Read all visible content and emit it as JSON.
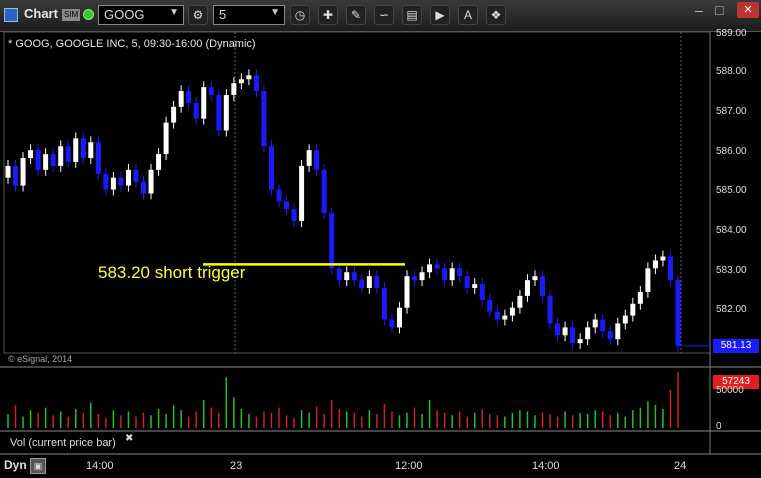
{
  "window": {
    "title": "Chart",
    "sim_badge": "SIM",
    "symbol": "GOOG",
    "interval": "5",
    "minimize": "–",
    "maximize": "□",
    "close": "✕"
  },
  "toolbar_icons": [
    "crosshair-icon",
    "pencil-icon",
    "draw-icon",
    "get-icon",
    "play-icon",
    "text-icon",
    "cursor-icon"
  ],
  "chart": {
    "title": "* GOOG, GOOGLE INC, 5, 09:30-16:00 (Dynamic)",
    "copyright": "© eSignal, 2014",
    "annotation": "583.20 short trigger",
    "last_price": "581.13",
    "price_ticks": [
      "589.00",
      "588.00",
      "587.00",
      "586.00",
      "585.00",
      "584.00",
      "583.00",
      "582.00"
    ],
    "time_ticks": [
      "14:00",
      "23",
      "12:00",
      "14:00",
      "24"
    ],
    "volume_label": "Vol (current price bar)",
    "volume_close": "✖",
    "volume_last": "57243",
    "volume_ticks": [
      "50000",
      "0"
    ],
    "bottom_label": "Dyn",
    "colors": {
      "up": "#ffffff",
      "down": "#1a1aff",
      "trigger": "#ffff00",
      "vol_up": "#22c222",
      "vol_down": "#d02020"
    }
  },
  "chart_data": {
    "type": "candlestick",
    "trigger_level": 583.2,
    "ylim": [
      580.95,
      589.1
    ],
    "last": 581.13,
    "closes": [
      585.7,
      585.2,
      585.9,
      586.1,
      585.6,
      586.0,
      585.7,
      586.2,
      585.8,
      586.4,
      585.9,
      586.3,
      585.5,
      585.1,
      585.4,
      585.2,
      585.6,
      585.3,
      585.0,
      585.6,
      586.0,
      586.8,
      587.2,
      587.6,
      587.3,
      586.9,
      587.7,
      587.5,
      586.6,
      587.5,
      587.8,
      587.9,
      588.0,
      587.6,
      586.2,
      585.1,
      584.8,
      584.6,
      584.3,
      585.7,
      586.1,
      585.6,
      584.5,
      583.1,
      582.8,
      583.0,
      582.8,
      582.6,
      582.9,
      582.6,
      581.8,
      581.6,
      582.1,
      582.9,
      582.8,
      583.0,
      583.2,
      583.1,
      582.8,
      583.1,
      582.9,
      582.6,
      582.7,
      582.3,
      582.0,
      581.8,
      581.9,
      582.1,
      582.4,
      582.8,
      582.9,
      582.4,
      581.7,
      581.4,
      581.6,
      581.2,
      581.3,
      581.6,
      581.8,
      581.5,
      581.3,
      581.7,
      581.9,
      582.2,
      582.5,
      583.1,
      583.3,
      583.4,
      582.8,
      581.13
    ],
    "volumes": [
      11,
      18,
      9,
      14,
      12,
      16,
      10,
      13,
      9,
      15,
      12,
      20,
      11,
      8,
      14,
      10,
      13,
      9,
      12,
      10,
      15,
      11,
      18,
      14,
      9,
      13,
      22,
      16,
      12,
      40,
      24,
      15,
      11,
      9,
      13,
      12,
      16,
      10,
      8,
      14,
      12,
      17,
      11,
      22,
      15,
      13,
      12,
      9,
      14,
      11,
      19,
      13,
      10,
      12,
      16,
      11,
      22,
      14,
      12,
      10,
      13,
      9,
      12,
      15,
      11,
      10,
      9,
      12,
      14,
      13,
      10,
      12,
      11,
      9,
      13,
      10,
      12,
      11,
      14,
      13,
      10,
      12,
      9,
      14,
      16,
      21,
      18,
      15,
      30,
      44
    ]
  }
}
